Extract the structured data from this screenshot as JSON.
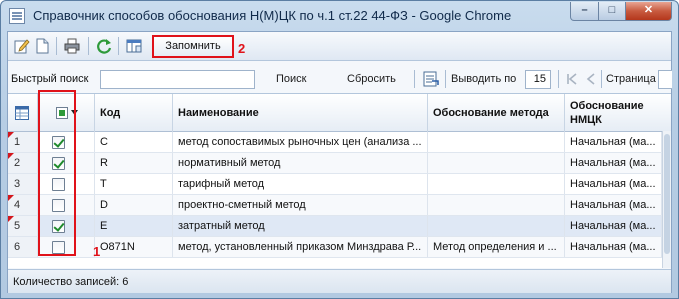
{
  "window": {
    "title": "Справочник способов обоснования Н(М)ЦК по ч.1 ст.22 44-ФЗ - Google Chrome",
    "minimize_label": "–",
    "maximize_label": "□",
    "close_label": "✕"
  },
  "toolbar": {
    "icons": [
      "edit-icon",
      "new-document-icon",
      "print-icon",
      "refresh-icon",
      "columns-icon"
    ],
    "remember_label": "Запомнить",
    "annotation": "2"
  },
  "search": {
    "label": "Быстрый поиск",
    "value": "",
    "find_label": "Поиск",
    "reset_label": "Сбросить",
    "page_size_label": "Выводить по",
    "page_size": "15",
    "page_label": "Страница"
  },
  "grid": {
    "columns": [
      "Код",
      "Наименование",
      "Обоснование метода",
      "Обоснование НМЦК"
    ],
    "rows": [
      {
        "num": "1",
        "checked": true,
        "dirty": true,
        "code": "C",
        "name": "метод сопоставимых рыночных цен (анализа ...",
        "method": "",
        "nmck": "Начальная (ма..."
      },
      {
        "num": "2",
        "checked": true,
        "dirty": true,
        "code": "R",
        "name": "нормативный метод",
        "method": "",
        "nmck": "Начальная (ма..."
      },
      {
        "num": "3",
        "checked": false,
        "dirty": false,
        "code": "T",
        "name": "тарифный метод",
        "method": "",
        "nmck": "Начальная (ма..."
      },
      {
        "num": "4",
        "checked": false,
        "dirty": true,
        "code": "D",
        "name": "проектно-сметный метод",
        "method": "",
        "nmck": "Начальная (ма..."
      },
      {
        "num": "5",
        "checked": true,
        "dirty": true,
        "code": "E",
        "name": "затратный метод",
        "method": "",
        "nmck": "Начальная (ма..."
      },
      {
        "num": "6",
        "checked": false,
        "dirty": false,
        "code": "O871N",
        "name": "метод, установленный приказом Минздрава Р...",
        "method": "Метод определения и ...",
        "nmck": "Начальная (ма..."
      }
    ],
    "annotation": "1"
  },
  "footer": {
    "count_label": "Количество записей: 6"
  },
  "colors": {
    "highlight": "#e0121a",
    "check": "#1f8a2c",
    "dirty_marker": "#d4161c"
  }
}
